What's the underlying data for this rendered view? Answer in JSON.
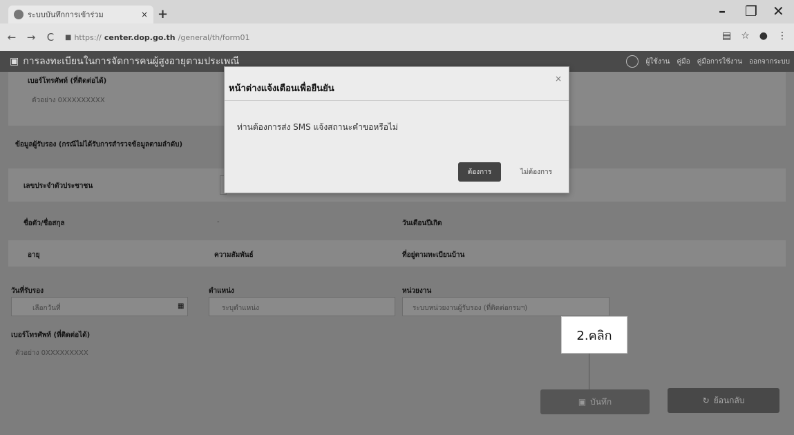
{
  "browser": {
    "tab_title": "ระบบบันทึกการเข้าร่วม",
    "tab_close": "×",
    "new_tab": "+",
    "url_prefix": "https://",
    "url_domain": "center.dop.go.th",
    "url_path": "/general/th/form01",
    "window_controls": [
      "–",
      "❐",
      "✕"
    ]
  },
  "appbar": {
    "title": "การลงทะเบียนในการจัดการคนผู้สูงอายุตามประเพณี",
    "user": "ผู้ใช้งาน",
    "menu_manual": "คู่มือ",
    "menu_guide": "คู่มือการใช้งาน",
    "menu_logout": "ออกจากระบบ"
  },
  "form": {
    "phone_label_top": "เบอร์โทรศัพท์ (ที่ติดต่อได้)",
    "phone_placeholder_top": "ตัวอย่าง 0XXXXXXXXX",
    "section_label": "ข้อมูลผู้รับรอง (กรณีไม่ได้รับการสำรวจข้อมูลตามลำดับ)",
    "id_label": "เลขประจำตัวประชาชน",
    "name_label": "ชื่อตัว/ชื่อสกุล",
    "name_value": "-",
    "birth_label": "วันเดือนปีเกิด",
    "age_label": "อายุ",
    "relation_label": "ความสัมพันธ์",
    "address_label": "ที่อยู่ตามทะเบียนบ้าน",
    "date_label": "วันที่รับรอง",
    "date_placeholder": "เลือกวันที่",
    "position_label": "ตำแหน่ง",
    "position_placeholder": "ระบุตำแหน่ง",
    "agency_label": "หน่วยงาน",
    "agency_value": "ระบบหน่วยงานผู้รับรอง (ที่ติดต่อกรมฯ)",
    "phone_label_bottom": "เบอร์โทรศัพท์ (ที่ติดต่อได้)",
    "phone_placeholder_bottom": "ตัวอย่าง 0XXXXXXXXX",
    "save_label": "บันทึก",
    "back_label": "ย้อนกลับ"
  },
  "callout": {
    "text": "2.คลิก"
  },
  "modal": {
    "title": "หน้าต่างแจ้งเตือนเพื่อยืนยัน",
    "close": "×",
    "message": "ท่านต้องการส่ง SMS แจ้งสถานะคำขอหรือไม่",
    "confirm_label": "ต้องการ",
    "cancel_label": "ไม่ต้องการ"
  },
  "icons": {
    "calendar": "calendar-icon",
    "save": "save-icon",
    "back": "back-icon",
    "avatar": "user-avatar-icon"
  }
}
